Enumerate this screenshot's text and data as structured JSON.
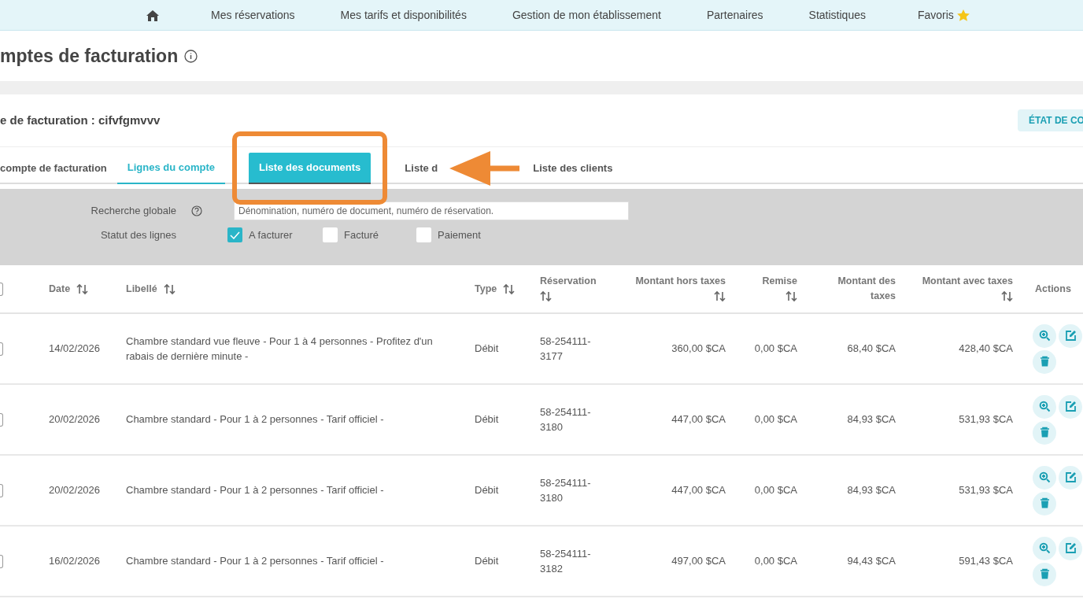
{
  "nav": {
    "items": [
      {
        "label": "Mes réservations"
      },
      {
        "label": "Mes tarifs et disponibilités"
      },
      {
        "label": "Gestion de mon établissement"
      },
      {
        "label": "Partenaires"
      },
      {
        "label": "Statistiques"
      }
    ],
    "favorites": "Favoris"
  },
  "page_title": "mptes de facturation",
  "account_heading": "e de facturation : cifvfgmvvv",
  "status_button": "ÉTAT DE CO",
  "tabs": [
    {
      "label": "compte de facturation",
      "selected": false,
      "highlighted": false
    },
    {
      "label": "Lignes du compte",
      "selected": true,
      "highlighted": false
    },
    {
      "label": "Liste des documents",
      "selected": false,
      "highlighted": true
    },
    {
      "label": "Liste d",
      "selected": false,
      "highlighted": false
    },
    {
      "label": "Liste des clients",
      "selected": false,
      "highlighted": false
    }
  ],
  "filters": {
    "search_label": "Recherche globale",
    "placeholder": "Dénomination, numéro de document, numéro de réservation.",
    "status_label": "Statut des lignes",
    "statuses": [
      {
        "label": "A facturer",
        "checked": true
      },
      {
        "label": "Facturé",
        "checked": false
      },
      {
        "label": "Paiement",
        "checked": false
      }
    ]
  },
  "table": {
    "select_all_checked": false,
    "columns": [
      {
        "label": "Date",
        "kind": "text",
        "sortable": true
      },
      {
        "label": "Libellé",
        "kind": "text",
        "sortable": true
      },
      {
        "label": "Type",
        "kind": "text",
        "sortable": true
      },
      {
        "label": "Réservation",
        "kind": "reference",
        "sortable": true
      },
      {
        "label": "Montant hors taxes",
        "kind": "amount",
        "sortable": true
      },
      {
        "label": "Remise",
        "kind": "amount",
        "sortable": true
      },
      {
        "label": "Montant des taxes",
        "kind": "amount",
        "sortable": false
      },
      {
        "label": "Montant avec taxes",
        "kind": "amount",
        "sortable": true
      },
      {
        "label": "Actions",
        "kind": "actions",
        "sortable": false
      }
    ],
    "rows": [
      {
        "checked": false,
        "cells": [
          "14/02/2026",
          "Chambre standard vue fleuve - Pour 1 à 4 personnes - Profitez d'un rabais de dernière minute -",
          "Débit",
          "58-254111-3177",
          "360,00 $CA",
          "0,00 $CA",
          "68,40 $CA",
          "428,40 $CA"
        ]
      },
      {
        "checked": false,
        "cells": [
          "20/02/2026",
          "Chambre standard - Pour 1 à 2 personnes - Tarif officiel -",
          "Débit",
          "58-254111-3180",
          "447,00 $CA",
          "0,00 $CA",
          "84,93 $CA",
          "531,93 $CA"
        ]
      },
      {
        "checked": false,
        "cells": [
          "20/02/2026",
          "Chambre standard - Pour 1 à 2 personnes - Tarif officiel -",
          "Débit",
          "58-254111-3180",
          "447,00 $CA",
          "0,00 $CA",
          "84,93 $CA",
          "531,93 $CA"
        ]
      },
      {
        "checked": false,
        "cells": [
          "16/02/2026",
          "Chambre standard - Pour 1 à 2 personnes - Tarif officiel -",
          "Débit",
          "58-254111-3182",
          "497,00 $CA",
          "0,00 $CA",
          "94,43 $CA",
          "591,43 $CA"
        ]
      }
    ]
  }
}
